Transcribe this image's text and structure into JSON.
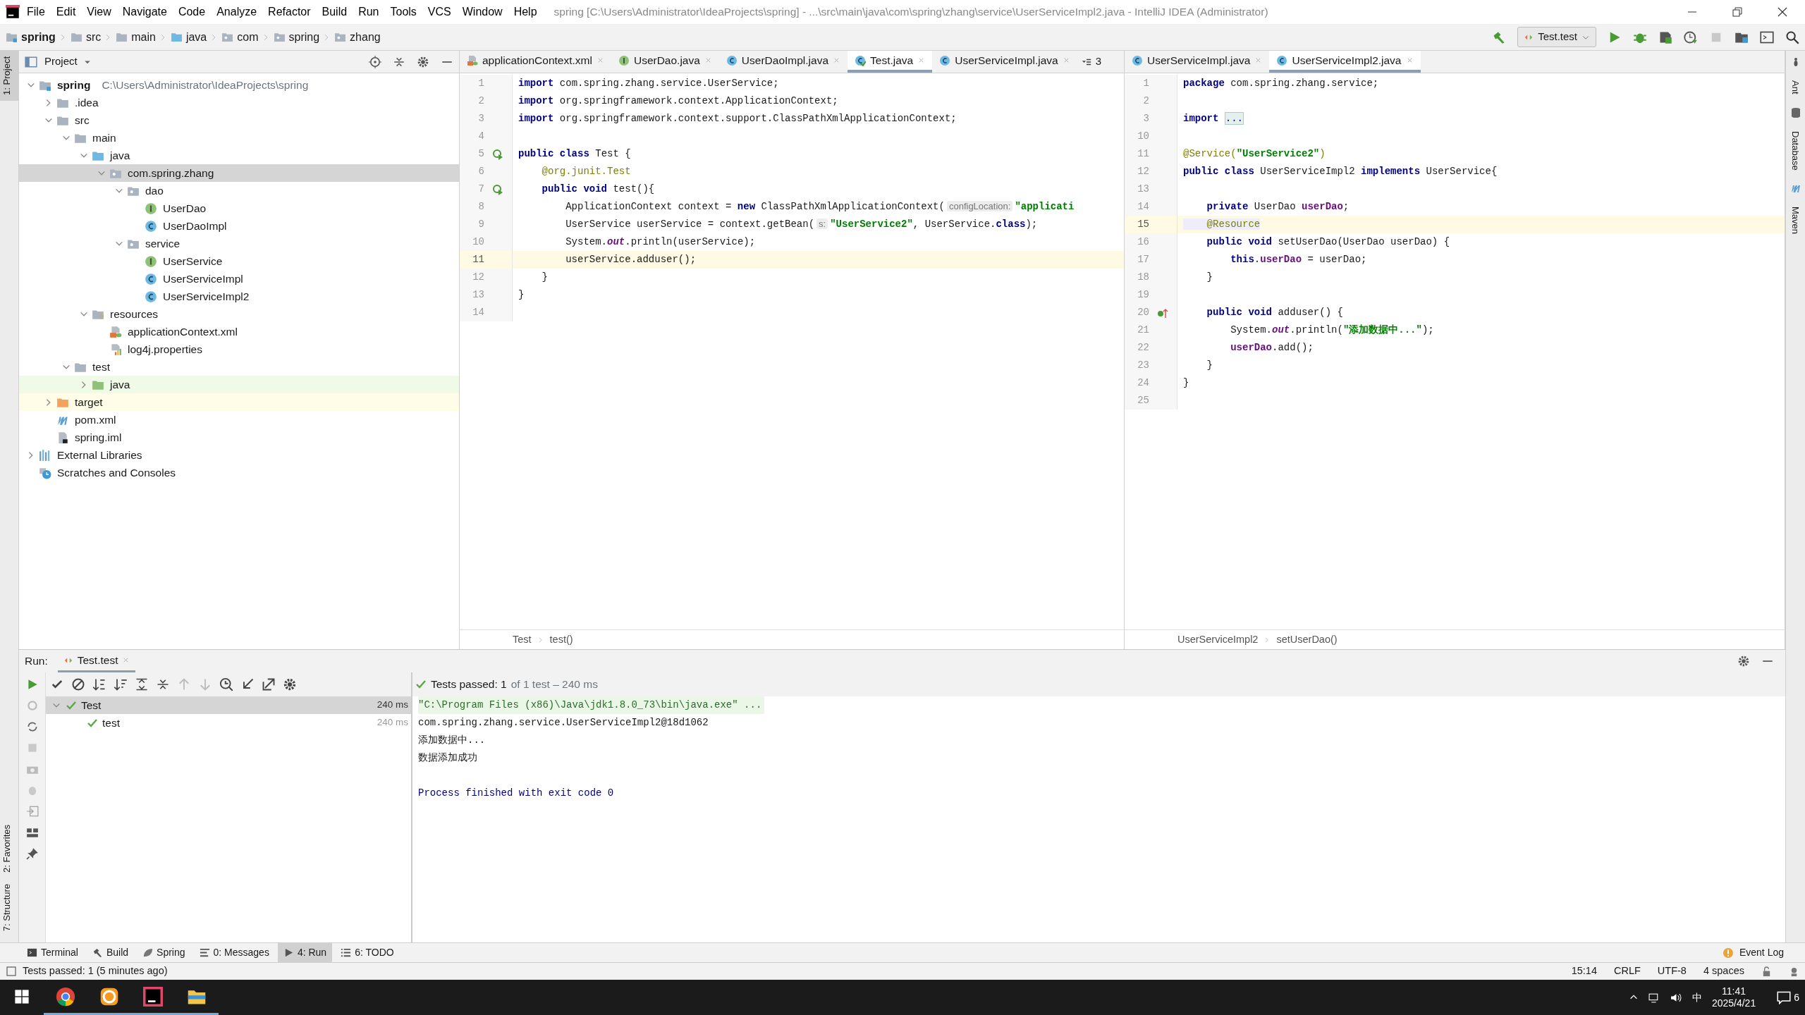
{
  "title_bar": {
    "menus": [
      "File",
      "Edit",
      "View",
      "Navigate",
      "Code",
      "Analyze",
      "Refactor",
      "Build",
      "Run",
      "Tools",
      "VCS",
      "Window",
      "Help"
    ],
    "title": "spring [C:\\Users\\Administrator\\IdeaProjects\\spring] - ...\\src\\main\\java\\com\\spring\\zhang\\service\\UserServiceImpl2.java - IntelliJ IDEA (Administrator)"
  },
  "breadcrumb": [
    {
      "label": "spring",
      "kind": "module"
    },
    {
      "label": "src",
      "kind": "folder"
    },
    {
      "label": "main",
      "kind": "folder"
    },
    {
      "label": "java",
      "kind": "source"
    },
    {
      "label": "com",
      "kind": "package"
    },
    {
      "label": "spring",
      "kind": "package"
    },
    {
      "label": "zhang",
      "kind": "package"
    }
  ],
  "run_config": "Test.test",
  "side_stripes": {
    "left_top": [
      {
        "label": "1: Project",
        "selected": true
      }
    ],
    "left_bottom": [
      {
        "label": "2: Favorites",
        "selected": false
      },
      {
        "label": "7: Structure",
        "selected": false
      }
    ],
    "right": [
      "Ant",
      "Database",
      "Maven"
    ]
  },
  "project_panel": {
    "title": "Project",
    "tree": [
      {
        "label": "spring",
        "path": "C:\\Users\\Administrator\\IdeaProjects\\spring",
        "kind": "module",
        "expanded": true,
        "selected": false,
        "children": [
          {
            "label": ".idea",
            "kind": "folder",
            "expanded": false,
            "selected": false
          },
          {
            "label": "src",
            "kind": "folder",
            "expanded": true,
            "selected": false,
            "children": [
              {
                "label": "main",
                "kind": "folder",
                "expanded": true,
                "selected": false,
                "children": [
                  {
                    "label": "java",
                    "kind": "source",
                    "expanded": true,
                    "selected": false,
                    "children": [
                      {
                        "label": "com.spring.zhang",
                        "kind": "package",
                        "expanded": true,
                        "selected": true,
                        "children": [
                          {
                            "label": "dao",
                            "kind": "package",
                            "expanded": true,
                            "selected": false,
                            "children": [
                              {
                                "label": "UserDao",
                                "kind": "interface",
                                "selected": false
                              },
                              {
                                "label": "UserDaoImpl",
                                "kind": "class",
                                "selected": false
                              }
                            ]
                          },
                          {
                            "label": "service",
                            "kind": "package",
                            "expanded": true,
                            "selected": false,
                            "children": [
                              {
                                "label": "UserService",
                                "kind": "interface",
                                "selected": false
                              },
                              {
                                "label": "UserServiceImpl",
                                "kind": "class",
                                "selected": false
                              },
                              {
                                "label": "UserServiceImpl2",
                                "kind": "class",
                                "selected": false
                              }
                            ]
                          }
                        ]
                      }
                    ]
                  },
                  {
                    "label": "resources",
                    "kind": "resources",
                    "expanded": true,
                    "selected": false,
                    "children": [
                      {
                        "label": "applicationContext.xml",
                        "kind": "xml",
                        "selected": false
                      },
                      {
                        "label": "log4j.properties",
                        "kind": "properties",
                        "selected": false
                      }
                    ]
                  }
                ]
              },
              {
                "label": "test",
                "kind": "folder",
                "expanded": true,
                "selected": false,
                "children": [
                  {
                    "label": "java",
                    "kind": "test",
                    "expanded": false,
                    "selected": false,
                    "color": "#effae7"
                  }
                ]
              }
            ]
          },
          {
            "label": "target",
            "kind": "excluded",
            "expanded": false,
            "selected": false,
            "color": "#fffde7"
          },
          {
            "label": "pom.xml",
            "kind": "maven",
            "selected": false
          },
          {
            "label": "spring.iml",
            "kind": "iml",
            "selected": false
          }
        ]
      },
      {
        "label": "External Libraries",
        "kind": "libraries",
        "expanded": false,
        "selected": false
      },
      {
        "label": "Scratches and Consoles",
        "kind": "scratches",
        "selected": false
      }
    ]
  },
  "editors": [
    {
      "tabs": [
        {
          "label": "applicationContext.xml",
          "kind": "xml",
          "selected": false
        },
        {
          "label": "UserDao.java",
          "kind": "interface",
          "selected": false
        },
        {
          "label": "UserDaoImpl.java",
          "kind": "class",
          "selected": false
        },
        {
          "label": "Test.java",
          "kind": "test",
          "selected": true
        },
        {
          "label": "UserServiceImpl.java",
          "kind": "class",
          "selected": false
        }
      ],
      "overflow": "3",
      "lines": [
        {
          "number": "1",
          "kind": "plain",
          "current": false,
          "tokens": [
            {
              "kind": "keyword",
              "text": "import"
            },
            {
              "kind": "plain",
              "text": " com.spring.zhang.service.UserService;"
            }
          ]
        },
        {
          "number": "2",
          "kind": "plain",
          "current": false,
          "tokens": [
            {
              "kind": "keyword",
              "text": "import"
            },
            {
              "kind": "plain",
              "text": " org.springframework.context.ApplicationContext;"
            }
          ]
        },
        {
          "number": "3",
          "kind": "plain",
          "current": false,
          "tokens": [
            {
              "kind": "keyword",
              "text": "import"
            },
            {
              "kind": "plain",
              "text": " org.springframework.context.support.ClassPathXmlApplicationContext;"
            }
          ]
        },
        {
          "number": "4",
          "kind": "plain",
          "current": false
        },
        {
          "number": "5",
          "kind": "runnable",
          "current": false,
          "tokens": [
            {
              "kind": "keyword",
              "text": "public class"
            },
            {
              "kind": "plain",
              "text": " Test {"
            }
          ]
        },
        {
          "number": "6",
          "kind": "plain",
          "current": false,
          "tokens": [
            {
              "kind": "annotation",
              "text": "    @org.junit.Test"
            }
          ]
        },
        {
          "number": "7",
          "kind": "runnable",
          "current": false,
          "tokens": [
            {
              "kind": "keyword",
              "text": "    public void"
            },
            {
              "kind": "plain",
              "text": " test(){"
            }
          ]
        },
        {
          "number": "8",
          "kind": "plain",
          "current": false,
          "tokens": [
            {
              "kind": "plain",
              "text": "        ApplicationContext context = "
            },
            {
              "kind": "keyword",
              "text": "new"
            },
            {
              "kind": "plain",
              "text": " ClassPathXmlApplicationContext("
            },
            {
              "kind": "hint",
              "text": "configLocation:"
            },
            {
              "kind": "string",
              "text": "\"applicati"
            }
          ]
        },
        {
          "number": "9",
          "kind": "plain",
          "current": false,
          "tokens": [
            {
              "kind": "plain",
              "text": "        UserService userService = context.getBean("
            },
            {
              "kind": "hint",
              "text": "s:"
            },
            {
              "kind": "string",
              "text": "\"UserService2\""
            },
            {
              "kind": "plain",
              "text": ", UserService."
            },
            {
              "kind": "keyword",
              "text": "class"
            },
            {
              "kind": "plain",
              "text": ");"
            }
          ]
        },
        {
          "number": "10",
          "kind": "plain",
          "current": false,
          "tokens": [
            {
              "kind": "plain",
              "text": "        System."
            },
            {
              "kind": "static",
              "text": "out"
            },
            {
              "kind": "plain",
              "text": ".println(userService);"
            }
          ]
        },
        {
          "number": "11",
          "kind": "plain",
          "current": true,
          "tokens": [
            {
              "kind": "plain",
              "text": "        userService.adduser();"
            }
          ]
        },
        {
          "number": "12",
          "kind": "plain",
          "current": false,
          "tokens": [
            {
              "kind": "plain",
              "text": "    }"
            }
          ]
        },
        {
          "number": "13",
          "kind": "plain",
          "current": false,
          "tokens": [
            {
              "kind": "plain",
              "text": "}"
            }
          ]
        },
        {
          "number": "14",
          "kind": "plain",
          "current": false
        }
      ],
      "breadcrumb": [
        "Test",
        "test()"
      ]
    },
    {
      "tabs": [
        {
          "label": "UserServiceImpl.java",
          "kind": "class",
          "selected": false
        },
        {
          "label": "UserServiceImpl2.java",
          "kind": "class",
          "selected": true
        }
      ],
      "lines": [
        {
          "number": "1",
          "kind": "plain",
          "current": false,
          "tokens": [
            {
              "kind": "keyword",
              "text": "package"
            },
            {
              "kind": "plain",
              "text": " com.spring.zhang.service;"
            }
          ]
        },
        {
          "number": "2",
          "kind": "plain",
          "current": false
        },
        {
          "number": "3",
          "kind": "plain",
          "current": false,
          "tokens": [
            {
              "kind": "keyword",
              "text": "import "
            },
            {
              "kind": "fold",
              "text": "..."
            }
          ]
        },
        {
          "number": "10",
          "kind": "plain",
          "current": false
        },
        {
          "number": "11",
          "kind": "plain",
          "current": false,
          "tokens": [
            {
              "kind": "annotation",
              "text": "@Service("
            },
            {
              "kind": "string",
              "text": "\"UserService2\""
            },
            {
              "kind": "annotation",
              "text": ")"
            }
          ]
        },
        {
          "number": "12",
          "kind": "plain",
          "current": false,
          "tokens": [
            {
              "kind": "keyword",
              "text": "public class"
            },
            {
              "kind": "plain",
              "text": " UserServiceImpl2 "
            },
            {
              "kind": "keyword",
              "text": "implements"
            },
            {
              "kind": "plain",
              "text": " UserService{"
            }
          ]
        },
        {
          "number": "13",
          "kind": "plain",
          "current": false
        },
        {
          "number": "14",
          "kind": "plain",
          "current": false,
          "tokens": [
            {
              "kind": "keyword",
              "text": "    private"
            },
            {
              "kind": "plain",
              "text": " UserDao "
            },
            {
              "kind": "field",
              "text": "userDao"
            },
            {
              "kind": "plain",
              "text": ";"
            }
          ]
        },
        {
          "number": "15",
          "kind": "plain",
          "current": true,
          "tokens": [
            {
              "kind": "annotation-highlight",
              "text": "    @Resource"
            }
          ]
        },
        {
          "number": "16",
          "kind": "plain",
          "current": false,
          "tokens": [
            {
              "kind": "keyword",
              "text": "    public void"
            },
            {
              "kind": "plain",
              "text": " setUserDao(UserDao userDao) {"
            }
          ]
        },
        {
          "number": "17",
          "kind": "plain",
          "current": false,
          "tokens": [
            {
              "kind": "keyword",
              "text": "        this"
            },
            {
              "kind": "plain",
              "text": "."
            },
            {
              "kind": "field",
              "text": "userDao"
            },
            {
              "kind": "plain",
              "text": " = userDao;"
            }
          ]
        },
        {
          "number": "18",
          "kind": "plain",
          "current": false,
          "tokens": [
            {
              "kind": "plain",
              "text": "    }"
            }
          ]
        },
        {
          "number": "19",
          "kind": "plain",
          "current": false
        },
        {
          "number": "20",
          "kind": "implements",
          "current": false,
          "tokens": [
            {
              "kind": "keyword",
              "text": "    public void"
            },
            {
              "kind": "plain",
              "text": " adduser() {"
            }
          ]
        },
        {
          "number": "21",
          "kind": "plain",
          "current": false,
          "tokens": [
            {
              "kind": "plain",
              "text": "        System."
            },
            {
              "kind": "static",
              "text": "out"
            },
            {
              "kind": "plain",
              "text": ".println("
            },
            {
              "kind": "string",
              "text": "\"添加数据中...\""
            },
            {
              "kind": "plain",
              "text": ");"
            }
          ]
        },
        {
          "number": "22",
          "kind": "plain",
          "current": false,
          "tokens": [
            {
              "kind": "field",
              "text": "        userDao"
            },
            {
              "kind": "plain",
              "text": ".add();"
            }
          ]
        },
        {
          "number": "23",
          "kind": "plain",
          "current": false,
          "tokens": [
            {
              "kind": "plain",
              "text": "    }"
            }
          ]
        },
        {
          "number": "24",
          "kind": "plain",
          "current": false,
          "tokens": [
            {
              "kind": "plain",
              "text": "}"
            }
          ]
        },
        {
          "number": "25",
          "kind": "plain",
          "current": false
        }
      ],
      "breadcrumb": [
        "UserServiceImpl2",
        "setUserDao()"
      ]
    }
  ],
  "run_panel": {
    "label": "Run:",
    "tab": "Test.test",
    "status": "Tests passed: 1",
    "status_detail": "of 1 test – 240 ms",
    "tests": [
      {
        "label": "Test",
        "time": "240 ms",
        "selected": true,
        "children": [
          {
            "label": "test",
            "time": "240 ms",
            "selected": false
          }
        ]
      }
    ],
    "console": [
      {
        "kind": "command",
        "text": "\"C:\\Program Files (x86)\\Java\\jdk1.8.0_73\\bin\\java.exe\" ..."
      },
      {
        "kind": "output",
        "text": "com.spring.zhang.service.UserServiceImpl2@18d1062"
      },
      {
        "kind": "output",
        "text": "添加数据中..."
      },
      {
        "kind": "output",
        "text": "数据添加成功"
      },
      {
        "kind": "blank"
      },
      {
        "kind": "exit",
        "text": "Process finished with exit code 0"
      }
    ]
  },
  "tool_windows": [
    {
      "label": "Terminal",
      "kind": "terminal",
      "selected": false
    },
    {
      "label": "Build",
      "kind": "build",
      "selected": false
    },
    {
      "label": "Spring",
      "kind": "spring",
      "selected": false
    },
    {
      "label": "0: Messages",
      "kind": "messages",
      "selected": false
    },
    {
      "label": "4: Run",
      "kind": "run",
      "selected": true
    },
    {
      "label": "6: TODO",
      "kind": "todo",
      "selected": false
    }
  ],
  "event_log": "Event Log",
  "status_bar": {
    "message": "Tests passed: 1 (5 minutes ago)",
    "items": [
      "15:14",
      "CRLF",
      "UTF-8",
      "4 spaces"
    ]
  },
  "taskbar": {
    "apps": [
      {
        "kind": "chrome"
      },
      {
        "kind": "orange"
      },
      {
        "kind": "ide"
      },
      {
        "kind": "explorer"
      }
    ],
    "ime": "中",
    "time": "11:41",
    "date": "2025/4/21",
    "notifications": "6"
  }
}
